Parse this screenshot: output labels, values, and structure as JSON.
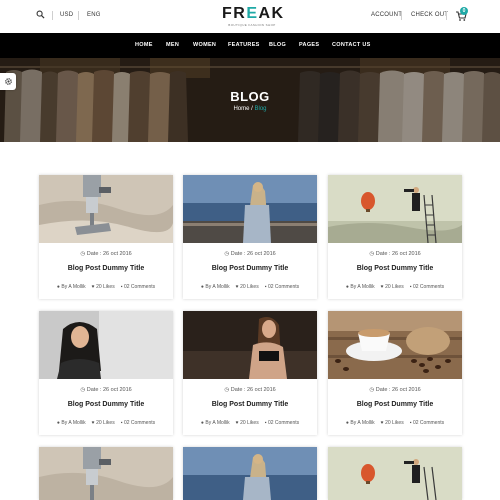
{
  "topbar": {
    "currency": "USD",
    "language": "ENG",
    "account": "ACCOUNT",
    "checkout": "CHECK OUT",
    "cart_count": "0",
    "icons": [
      "search-icon",
      "cart-icon"
    ]
  },
  "logo": {
    "name_part1": "FR",
    "name_accent": "E",
    "name_part2": "AK",
    "tagline": "BOUTIQUE FASHION SHOP"
  },
  "nav": {
    "items": [
      "HOME",
      "MEN",
      "WOMEN",
      "FEATURES",
      "BLOG",
      "PAGES",
      "CONTACT US"
    ]
  },
  "hero": {
    "title": "BLOG",
    "breadcrumb_home": "Home",
    "breadcrumb_sep": " / ",
    "breadcrumb_current": "Blog"
  },
  "colors": {
    "accent": "#1fa9a6",
    "nav_bg": "#000000"
  },
  "posts": [
    {
      "date": "Date : 26 oct 2016",
      "title": "Blog Post Dummy Title",
      "author": "By A Mollik",
      "likes": "20 Likes",
      "comments": "02 Comments",
      "image": "sewing-machine"
    },
    {
      "date": "Date : 26 oct 2016",
      "title": "Blog Post Dummy Title",
      "author": "By A Mollik",
      "likes": "20 Likes",
      "comments": "02 Comments",
      "image": "woman-seaside"
    },
    {
      "date": "Date : 26 oct 2016",
      "title": "Blog Post Dummy Title",
      "author": "By A Mollik",
      "likes": "20 Likes",
      "comments": "02 Comments",
      "image": "balloon-telescope"
    },
    {
      "date": "Date : 26 oct 2016",
      "title": "Blog Post Dummy Title",
      "author": "By A Mollik",
      "likes": "20 Likes",
      "comments": "02 Comments",
      "image": "smiling-woman"
    },
    {
      "date": "Date : 26 oct 2016",
      "title": "Blog Post Dummy Title",
      "author": "By A Mollik",
      "likes": "20 Likes",
      "comments": "02 Comments",
      "image": "woman-sitting"
    },
    {
      "date": "Date : 26 oct 2016",
      "title": "Blog Post Dummy Title",
      "author": "By A Mollik",
      "likes": "20 Likes",
      "comments": "02 Comments",
      "image": "coffee-cup"
    }
  ]
}
